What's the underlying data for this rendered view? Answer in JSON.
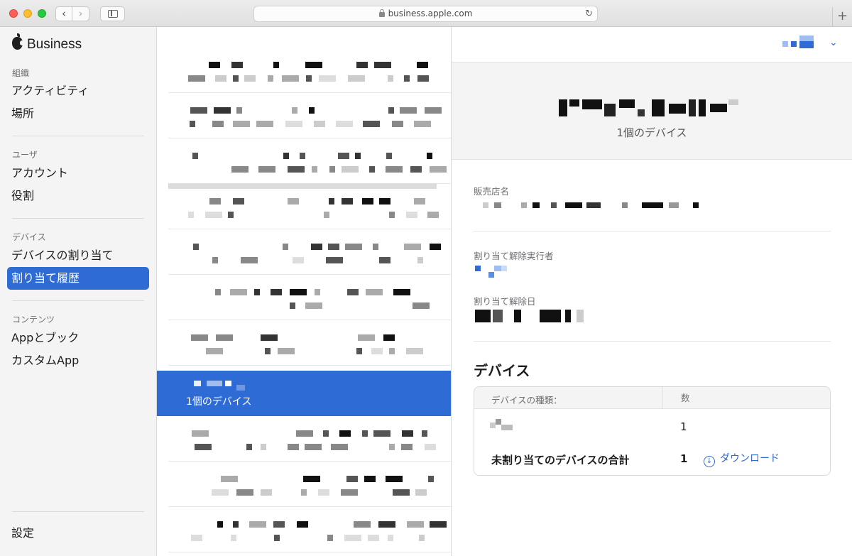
{
  "browser": {
    "url": "business.apple.com",
    "back_glyph": "‹",
    "forward_glyph": "›",
    "reload_glyph": "↻",
    "newtab_glyph": "+"
  },
  "brand": {
    "name": "Business"
  },
  "nav": {
    "sections": [
      {
        "label": "組織",
        "items": [
          "アクティビティ",
          "場所"
        ]
      },
      {
        "label": "ユーザ",
        "items": [
          "アカウント",
          "役割"
        ]
      },
      {
        "label": "デバイス",
        "items": [
          "デバイスの割り当て",
          "割り当て履歴"
        ]
      },
      {
        "label": "コンテンツ",
        "items": [
          "Appとブック",
          "カスタムApp"
        ]
      }
    ],
    "active_item": "割り当て履歴",
    "settings": "設定"
  },
  "list": {
    "selected_row_count": "1個のデバイス",
    "redacted": true
  },
  "detail": {
    "header_count": "1個のデバイス",
    "fields": {
      "reseller_label": "販売店名",
      "unassigned_by_label": "割り当て解除実行者",
      "unassigned_date_label": "割り当て解除日"
    },
    "devices_title": "デバイス",
    "table": {
      "col_type": "デバイスの種類：",
      "col_count": "数",
      "row_count": "1",
      "total_label": "未割り当てのデバイスの合計",
      "total_count": "1",
      "download_label": "ダウンロード",
      "download_glyph": "↓"
    }
  },
  "colors": {
    "accent": "#2f6bd4",
    "sidebar_bg": "#f4f4f4",
    "header_bg": "#f4f4f4"
  }
}
